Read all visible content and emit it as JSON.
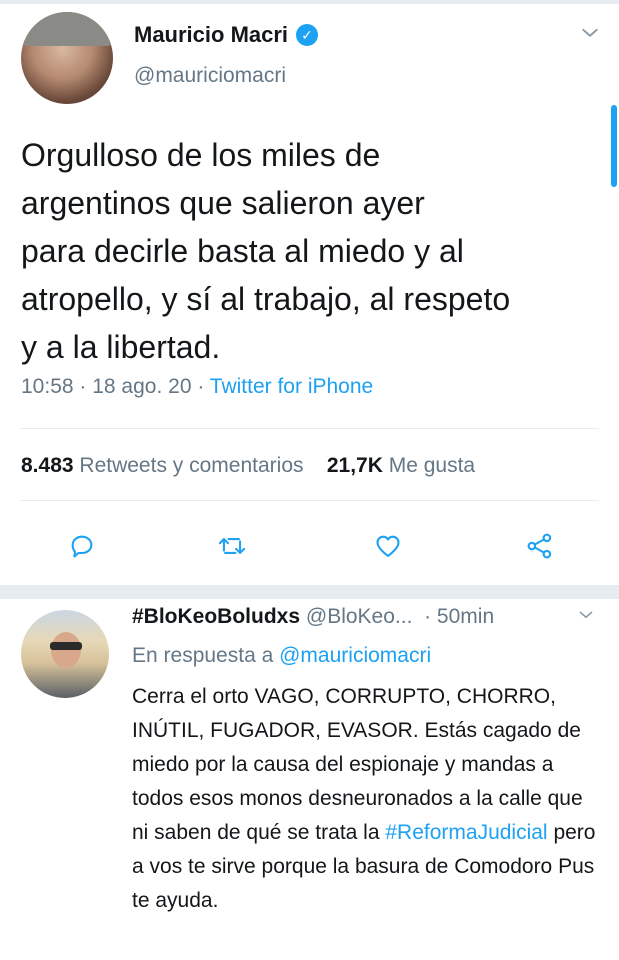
{
  "main_tweet": {
    "display_name": "Mauricio Macri",
    "handle": "@mauriciomacri",
    "text": "Orgulloso de los miles de\nargentinos que salieron ayer\npara decirle basta al miedo y al\natropello, y sí al trabajo, al respeto\ny a la libertad.",
    "time": "10:58",
    "date": "18 ago. 20",
    "separator": " · ",
    "source": "Twitter for iPhone",
    "retweets_count": "8.483",
    "retweets_label": "Retweets y comentarios",
    "likes_count": "21,7K",
    "likes_label": "Me gusta"
  },
  "reply": {
    "display_name": "#BloKeoBoludxs",
    "handle": "@BloKeo...",
    "time": "· 50min",
    "reply_prefix": "En respuesta a",
    "reply_mention": "@mauriciomacri",
    "text_before_hashtag": "Cerra el orto VAGO, CORRUPTO, CHORRO, INÚTIL, FUGADOR, EVASOR. Estás cagado de miedo por la causa del espionaje y mandas a todos esos monos desneuronados a la calle que ni saben de qué se trata la",
    "hashtag": "#ReformaJudicial",
    "text_after_hashtag": "pero a vos te sirve porque la basura de Comodoro Pus te ayuda."
  },
  "icons": {
    "verified": "verified-badge-icon",
    "menu": "chevron-down-icon",
    "reply": "reply-icon",
    "retweet": "retweet-icon",
    "like": "heart-icon",
    "share": "share-icon"
  },
  "colors": {
    "accent": "#1da1f2",
    "secondary_text": "#657786",
    "primary_text": "#14171a",
    "divider": "#e6ecf0"
  }
}
